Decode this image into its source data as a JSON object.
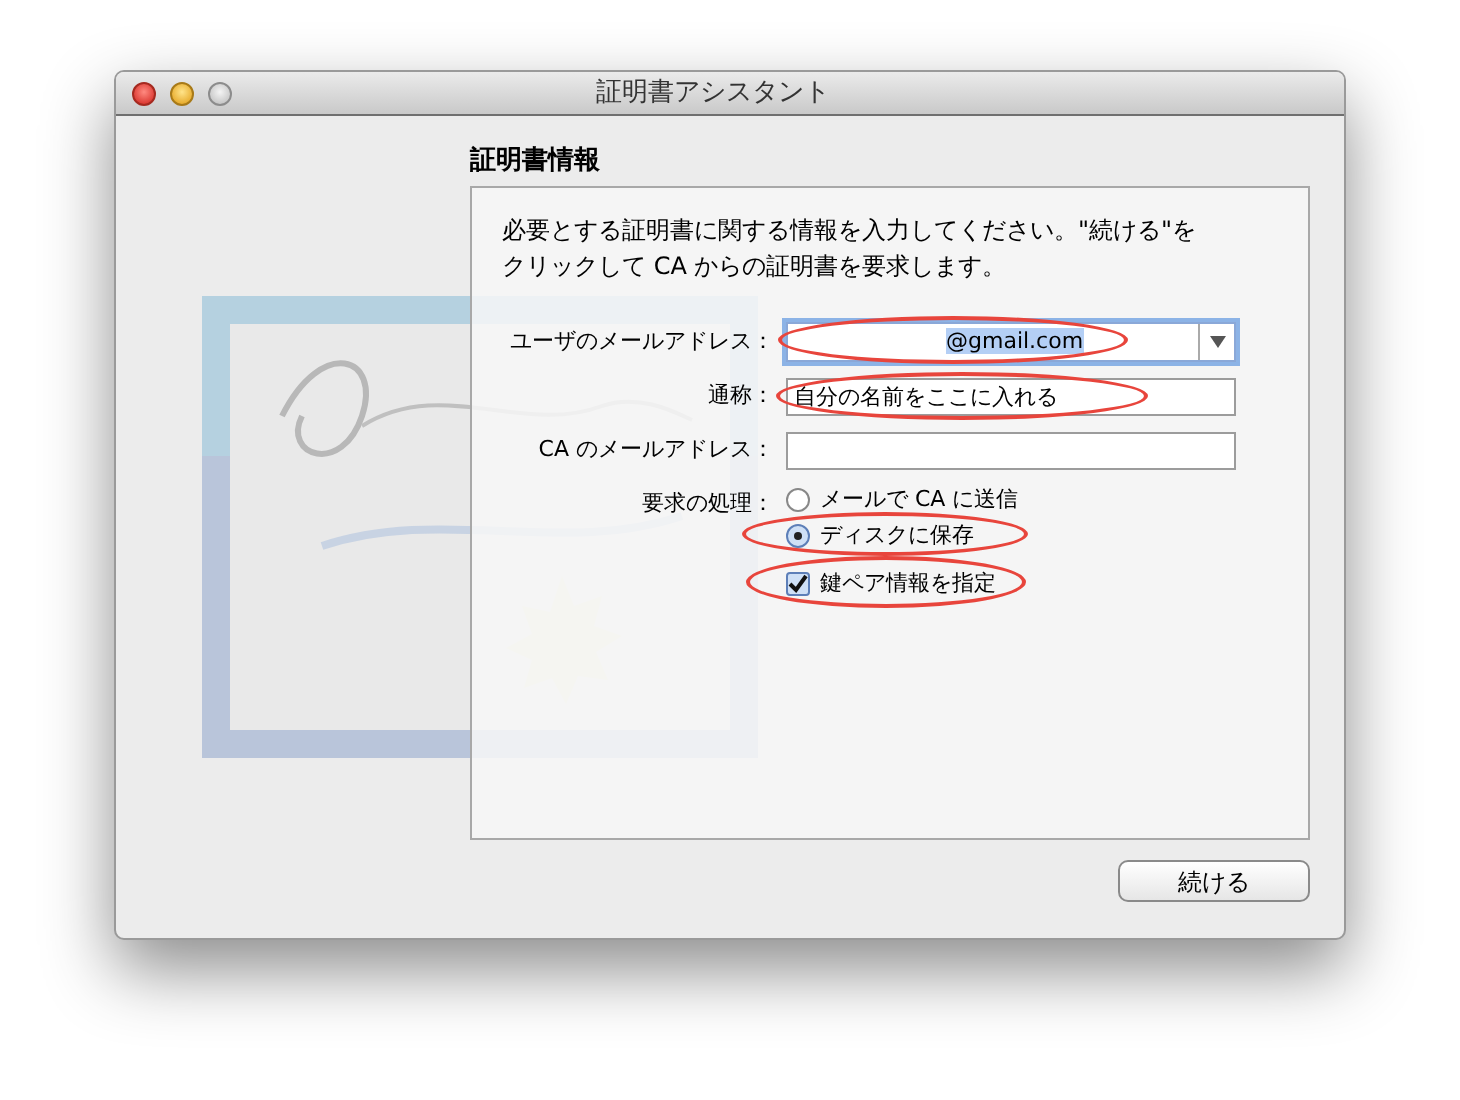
{
  "window": {
    "title": "証明書アシスタント"
  },
  "section_title": "証明書情報",
  "intro_lines": [
    "必要とする証明書に関する情報を入力してください。\"続ける\"を",
    "クリックして CA からの証明書を要求します。"
  ],
  "fields": [
    {
      "label": "ユーザのメールアドレス：",
      "value": "@gmail.com",
      "kind": "combo",
      "highlighted": true
    },
    {
      "label": "通称：",
      "value": "自分の名前をここに入れる",
      "kind": "text",
      "highlighted": true
    },
    {
      "label": "CA のメールアドレス：",
      "kind": "text",
      "highlighted": false
    }
  ],
  "request": {
    "label": "要求の処理：",
    "options": [
      {
        "label": "メールで CA に送信",
        "selected": false,
        "highlighted": false
      },
      {
        "label": "ディスクに保存",
        "selected": true,
        "highlighted": true
      }
    ],
    "checkbox": {
      "label": "鍵ペア情報を指定",
      "checked": true,
      "highlighted": true
    }
  },
  "buttons": [
    "続ける"
  ]
}
